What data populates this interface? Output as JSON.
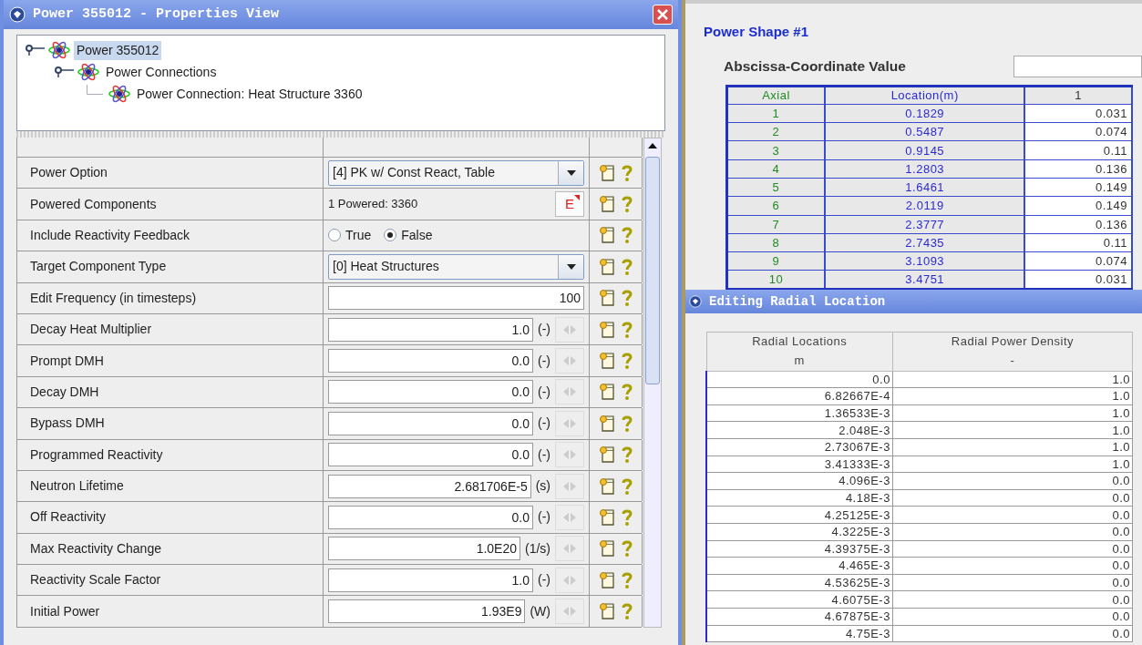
{
  "window": {
    "title": "Power 355012 - Properties View"
  },
  "tree": [
    {
      "label": "Power 355012",
      "selected": true,
      "expanded": true,
      "children": [
        {
          "label": "Power Connections",
          "selected": false,
          "expanded": true,
          "children": [
            {
              "label": "Power Connection: Heat Structure 3360",
              "selected": false
            }
          ]
        }
      ]
    }
  ],
  "properties": [
    {
      "kind": "combo",
      "label": "Power Option",
      "value": "[4] PK w/ Const React, Table"
    },
    {
      "kind": "link",
      "label": "Powered Components",
      "value": "1 Powered: 3360",
      "button": "E"
    },
    {
      "kind": "radio",
      "label": "Include Reactivity Feedback",
      "options": [
        {
          "label": "True",
          "selected": false
        },
        {
          "label": "False",
          "selected": true
        }
      ]
    },
    {
      "kind": "combo",
      "label": "Target Component Type",
      "value": "[0] Heat Structures"
    },
    {
      "kind": "number",
      "label": "Edit Frequency (in timesteps)",
      "value": "100"
    },
    {
      "kind": "unit",
      "label": "Decay Heat Multiplier",
      "value": "1.0",
      "unit": "(-)"
    },
    {
      "kind": "unit",
      "label": "Prompt DMH",
      "value": "0.0",
      "unit": "(-)"
    },
    {
      "kind": "unit",
      "label": "Decay DMH",
      "value": "0.0",
      "unit": "(-)"
    },
    {
      "kind": "unit",
      "label": "Bypass DMH",
      "value": "0.0",
      "unit": "(-)"
    },
    {
      "kind": "unit",
      "label": "Programmed Reactivity",
      "value": "0.0",
      "unit": "(-)"
    },
    {
      "kind": "unit",
      "label": "Neutron Lifetime",
      "value": "2.681706E-5",
      "unit": "(s)"
    },
    {
      "kind": "unit",
      "label": "Off Reactivity",
      "value": "0.0",
      "unit": "(-)"
    },
    {
      "kind": "unit",
      "label": "Max Reactivity Change",
      "value": "1.0E20",
      "unit": "(1/s)"
    },
    {
      "kind": "unit",
      "label": "Reactivity Scale Factor",
      "value": "1.0",
      "unit": "(-)"
    },
    {
      "kind": "unit",
      "label": "Initial Power",
      "value": "1.93E9",
      "unit": "(W)"
    }
  ],
  "power_shape": {
    "title": "Power Shape #1",
    "abscissa_label": "Abscissa-Coordinate Value",
    "columns": [
      "Axial",
      "Location(m)",
      "1"
    ],
    "rows": [
      [
        "1",
        "0.1829",
        "0.031"
      ],
      [
        "2",
        "0.5487",
        "0.074"
      ],
      [
        "3",
        "0.9145",
        "0.11"
      ],
      [
        "4",
        "1.2803",
        "0.136"
      ],
      [
        "5",
        "1.6461",
        "0.149"
      ],
      [
        "6",
        "2.0119",
        "0.149"
      ],
      [
        "7",
        "2.3777",
        "0.136"
      ],
      [
        "8",
        "2.7435",
        "0.11"
      ],
      [
        "9",
        "3.1093",
        "0.074"
      ],
      [
        "10",
        "3.4751",
        "0.031"
      ]
    ]
  },
  "radial_window": {
    "title": "Editing Radial Location",
    "columns": [
      {
        "name": "Radial Locations",
        "unit": "m"
      },
      {
        "name": "Radial Power Density",
        "unit": "-"
      }
    ],
    "rows": [
      [
        "0.0",
        "1.0"
      ],
      [
        "6.82667E-4",
        "1.0"
      ],
      [
        "1.36533E-3",
        "1.0"
      ],
      [
        "2.048E-3",
        "1.0"
      ],
      [
        "2.73067E-3",
        "1.0"
      ],
      [
        "3.41333E-3",
        "1.0"
      ],
      [
        "4.096E-3",
        "0.0"
      ],
      [
        "4.18E-3",
        "0.0"
      ],
      [
        "4.25125E-3",
        "0.0"
      ],
      [
        "4.3225E-3",
        "0.0"
      ],
      [
        "4.39375E-3",
        "0.0"
      ],
      [
        "4.465E-3",
        "0.0"
      ],
      [
        "4.53625E-3",
        "0.0"
      ],
      [
        "4.6075E-3",
        "0.0"
      ],
      [
        "4.67875E-3",
        "0.0"
      ],
      [
        "4.75E-3",
        "0.0"
      ]
    ]
  }
}
